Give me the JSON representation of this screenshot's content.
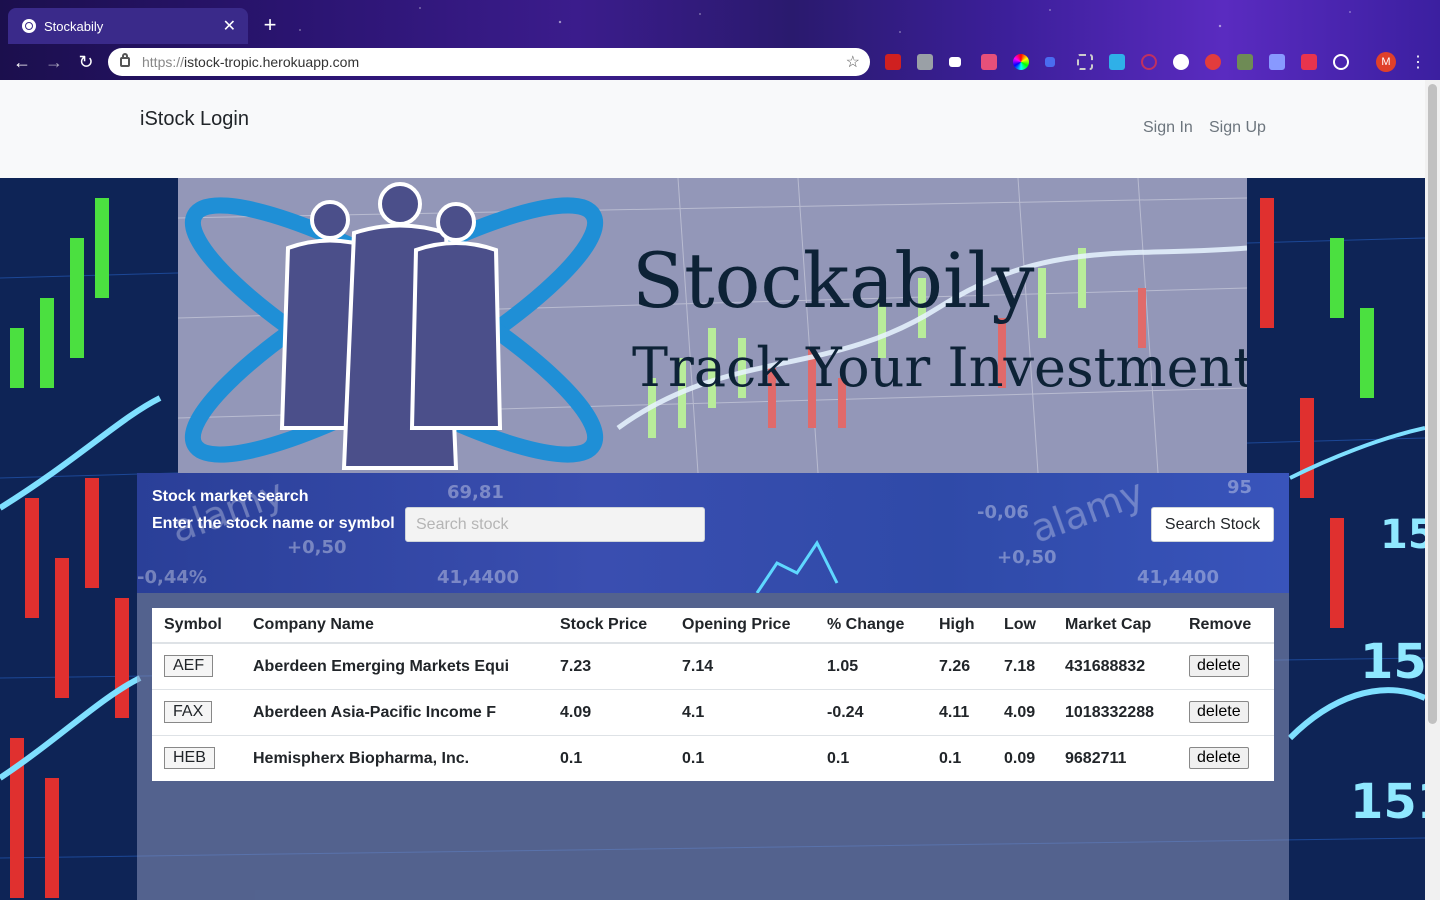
{
  "browser": {
    "tab_title": "Stockabily",
    "url_scheme": "https://",
    "url_host": "istock-tropic.herokuapp.com",
    "profile_initial": "M"
  },
  "nav": {
    "brand": "iStock Login",
    "sign_in": "Sign In",
    "sign_up": "Sign Up"
  },
  "hero": {
    "title": "Stockabily",
    "subtitle": "Track Your Investments"
  },
  "search": {
    "heading": "Stock market search",
    "prompt": "Enter the stock name or symbol",
    "placeholder": "Search stock",
    "button": "Search Stock"
  },
  "table": {
    "columns": [
      "Symbol",
      "Company Name",
      "Stock Price",
      "Opening Price",
      "% Change",
      "High",
      "Low",
      "Market Cap",
      "Remove"
    ],
    "delete_label": "delete",
    "rows": [
      {
        "symbol": "AEF",
        "company": "Aberdeen Emerging Markets Equi",
        "price": "7.23",
        "open": "7.14",
        "change": "1.05",
        "high": "7.26",
        "low": "7.18",
        "cap": "431688832"
      },
      {
        "symbol": "FAX",
        "company": "Aberdeen Asia-Pacific Income F",
        "price": "4.09",
        "open": "4.1",
        "change": "-0.24",
        "high": "4.11",
        "low": "4.09",
        "cap": "1018332288"
      },
      {
        "symbol": "HEB",
        "company": "Hemispherx Biopharma, Inc.",
        "price": "0.1",
        "open": "0.1",
        "change": "0.1",
        "high": "0.1",
        "low": "0.09",
        "cap": "9682711"
      }
    ]
  },
  "colors": {
    "title_navy": "#0d2236",
    "logo_blue": "#1f8fd6",
    "figures_purple": "#4b4f8a"
  }
}
